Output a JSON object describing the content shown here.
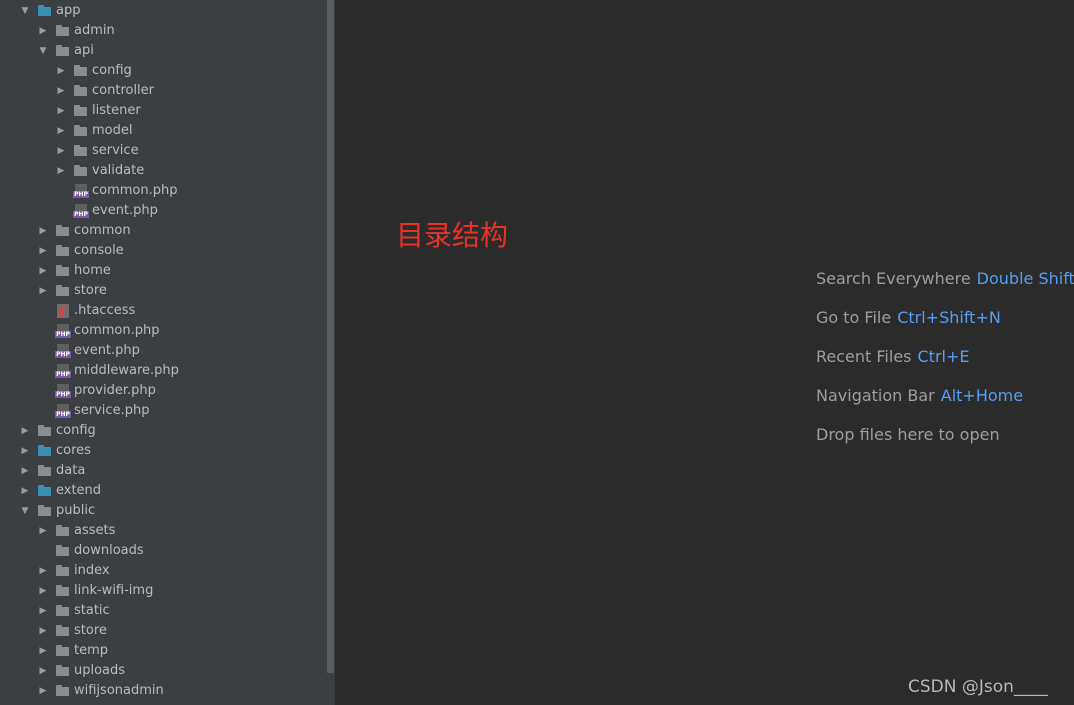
{
  "colors": {
    "sidebar_bg": "#3c3f41",
    "editor_bg": "#2b2b2b",
    "folder_grey": "#8a8d90",
    "folder_blue": "#3a8fb5",
    "php_badge": "#7a5aa8",
    "shortcut_key": "#589df6",
    "annotation": "#e5332a"
  },
  "project_tree": [
    {
      "label": "app",
      "type": "folder",
      "depth": 0,
      "expanded": true,
      "color": "blue"
    },
    {
      "label": "admin",
      "type": "folder",
      "depth": 1,
      "expanded": false,
      "color": "grey"
    },
    {
      "label": "api",
      "type": "folder",
      "depth": 1,
      "expanded": true,
      "color": "grey"
    },
    {
      "label": "config",
      "type": "folder",
      "depth": 2,
      "expanded": false,
      "color": "grey"
    },
    {
      "label": "controller",
      "type": "folder",
      "depth": 2,
      "expanded": false,
      "color": "grey"
    },
    {
      "label": "listener",
      "type": "folder",
      "depth": 2,
      "expanded": false,
      "color": "grey"
    },
    {
      "label": "model",
      "type": "folder",
      "depth": 2,
      "expanded": false,
      "color": "grey"
    },
    {
      "label": "service",
      "type": "folder",
      "depth": 2,
      "expanded": false,
      "color": "grey"
    },
    {
      "label": "validate",
      "type": "folder",
      "depth": 2,
      "expanded": false,
      "color": "grey"
    },
    {
      "label": "common.php",
      "type": "php",
      "depth": 2
    },
    {
      "label": "event.php",
      "type": "php",
      "depth": 2
    },
    {
      "label": "common",
      "type": "folder",
      "depth": 1,
      "expanded": false,
      "color": "grey"
    },
    {
      "label": "console",
      "type": "folder",
      "depth": 1,
      "expanded": false,
      "color": "grey"
    },
    {
      "label": "home",
      "type": "folder",
      "depth": 1,
      "expanded": false,
      "color": "grey"
    },
    {
      "label": "store",
      "type": "folder",
      "depth": 1,
      "expanded": false,
      "color": "grey"
    },
    {
      "label": ".htaccess",
      "type": "htaccess",
      "depth": 1
    },
    {
      "label": "common.php",
      "type": "php",
      "depth": 1
    },
    {
      "label": "event.php",
      "type": "php",
      "depth": 1
    },
    {
      "label": "middleware.php",
      "type": "php",
      "depth": 1
    },
    {
      "label": "provider.php",
      "type": "php",
      "depth": 1
    },
    {
      "label": "service.php",
      "type": "php",
      "depth": 1
    },
    {
      "label": "config",
      "type": "folder",
      "depth": 0,
      "expanded": false,
      "color": "grey"
    },
    {
      "label": "cores",
      "type": "folder",
      "depth": 0,
      "expanded": false,
      "color": "blue"
    },
    {
      "label": "data",
      "type": "folder",
      "depth": 0,
      "expanded": false,
      "color": "grey"
    },
    {
      "label": "extend",
      "type": "folder",
      "depth": 0,
      "expanded": false,
      "color": "blue"
    },
    {
      "label": "public",
      "type": "folder",
      "depth": 0,
      "expanded": true,
      "color": "grey"
    },
    {
      "label": "assets",
      "type": "folder",
      "depth": 1,
      "expanded": false,
      "color": "grey"
    },
    {
      "label": "downloads",
      "type": "folder",
      "depth": 1,
      "expanded": null,
      "color": "grey"
    },
    {
      "label": "index",
      "type": "folder",
      "depth": 1,
      "expanded": false,
      "color": "grey"
    },
    {
      "label": "link-wifi-img",
      "type": "folder",
      "depth": 1,
      "expanded": false,
      "color": "grey"
    },
    {
      "label": "static",
      "type": "folder",
      "depth": 1,
      "expanded": false,
      "color": "grey"
    },
    {
      "label": "store",
      "type": "folder",
      "depth": 1,
      "expanded": false,
      "color": "grey"
    },
    {
      "label": "temp",
      "type": "folder",
      "depth": 1,
      "expanded": false,
      "color": "grey"
    },
    {
      "label": "uploads",
      "type": "folder",
      "depth": 1,
      "expanded": false,
      "color": "grey"
    },
    {
      "label": "wifijsonadmin",
      "type": "folder",
      "depth": 1,
      "expanded": false,
      "color": "grey"
    }
  ],
  "annotation": {
    "text": "目录结构"
  },
  "editor_hints": [
    {
      "label": "Search Everywhere",
      "shortcut": "Double Shift"
    },
    {
      "label": "Go to File",
      "shortcut": "Ctrl+Shift+N"
    },
    {
      "label": "Recent Files",
      "shortcut": "Ctrl+E"
    },
    {
      "label": "Navigation Bar",
      "shortcut": "Alt+Home"
    },
    {
      "label": "Drop files here to open",
      "shortcut": ""
    }
  ],
  "watermark": {
    "text": "CSDN @Json____"
  }
}
